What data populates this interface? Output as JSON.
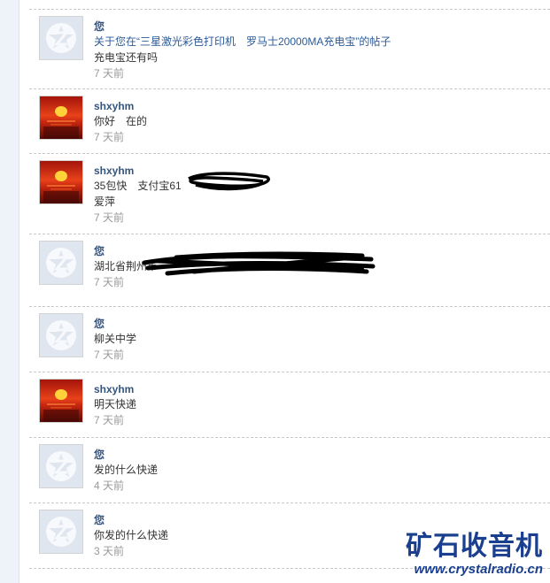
{
  "colors": {
    "name": "#36557c",
    "time": "#999999",
    "watermark": "#1a3f8f",
    "title_link": "#2b5a97"
  },
  "messages": [
    {
      "user": "您",
      "avatar": "default-qq-avatar",
      "text": "关于您在“三星激光彩色打印机　罗马士20000MA充电宝”的帖子",
      "text2": "充电宝还有吗",
      "time": "7 天前"
    },
    {
      "user": "shxyhm",
      "avatar": "sunset-avatar",
      "text": "你好　在的",
      "time": "7 天前"
    },
    {
      "user": "shxyhm",
      "avatar": "sunset-avatar",
      "text": "35包快　支付宝61",
      "text2": "爱萍",
      "time": "7 天前"
    },
    {
      "user": "您",
      "avatar": "default-qq-avatar",
      "text": "湖北省荆州市",
      "time": "7 天前"
    },
    {
      "user": "您",
      "avatar": "default-qq-avatar",
      "text": "柳关中学",
      "time": "7 天前"
    },
    {
      "user": "shxyhm",
      "avatar": "sunset-avatar",
      "text": "明天快递",
      "time": "7 天前"
    },
    {
      "user": "您",
      "avatar": "default-qq-avatar",
      "text": "发的什么快递",
      "time": "4 天前"
    },
    {
      "user": "您",
      "avatar": "default-qq-avatar",
      "text": "你发的什么快递",
      "time": "3 天前"
    }
  ],
  "watermark": {
    "title": "矿石收音机",
    "url": "www.crystalradio.cn"
  }
}
